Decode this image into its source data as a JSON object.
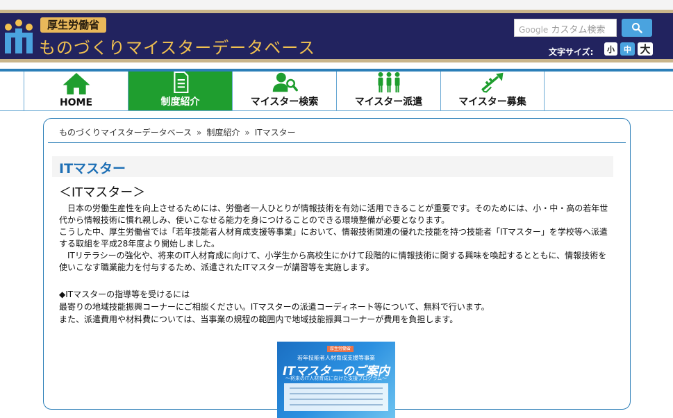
{
  "header": {
    "ministry": "厚生労働省",
    "site_title": "ものづくりマイスターデータベース",
    "search_google": "Google",
    "search_placeholder": "カスタム検索",
    "fontsize_label": "文字サイズ:",
    "fontsize_small": "小",
    "fontsize_mid": "中",
    "fontsize_large": "大",
    "colors": {
      "bg": "#22235f",
      "title": "#f0c050",
      "accent": "#4aa3df"
    }
  },
  "nav": {
    "items": [
      {
        "label": "HOME",
        "icon": "home-icon"
      },
      {
        "label": "制度紹介",
        "icon": "document-icon",
        "active": true
      },
      {
        "label": "マイスター検索",
        "icon": "person-search-icon"
      },
      {
        "label": "マイスター派遣",
        "icon": "people-icon"
      },
      {
        "label": "マイスター募集",
        "icon": "trumpet-icon"
      }
    ],
    "active_color": "#1f9e2f"
  },
  "breadcrumb": {
    "items": [
      "ものづくりマイスターデータベース",
      "制度紹介",
      "ITマスター"
    ],
    "separator": "»"
  },
  "page": {
    "title": "ITマスター",
    "subheading": "＜ITマスター＞",
    "paragraphs": [
      "　日本の労働生産性を向上させるためには、労働者一人ひとりが情報技術を有効に活用できることが重要です。そのためには、小・中・高の若年世代から情報技術に慣れ親しみ、使いこなせる能力を身につけることのできる環境整備が必要となります。",
      "こうした中、厚生労働省では「若年技能者人材育成支援等事業」において、情報技術関連の優れた技能を持つ技能者「ITマスター」を学校等へ派遣する取組を平成28年度より開始しました。",
      "　ITリテラシーの強化や、将来のIT人材育成に向けて、小学生から高校生にかけて段階的に情報技術に関する興味を喚起するとともに、情報技術を使いこなす職業能力を付与するため、派遣されたITマスターが講習等を実施します。"
    ],
    "section_title": "◆ITマスターの指導等を受けるには",
    "section_lines": [
      "最寄りの地域技能振興コーナーにご相談ください。ITマスターの派遣コーディネート等について、無料で行います。",
      "また、派遣費用や材料費については、当事業の規程の範囲内で地域技能振興コーナーが費用を負担します。"
    ]
  },
  "pamphlet": {
    "badge": "厚生労働省",
    "subtitle": "若年技能者人材育成支援等事業",
    "title": "ITマスターのご案内",
    "tagline": "〜将来のIT人材育成に向けた支援プログラム〜"
  }
}
